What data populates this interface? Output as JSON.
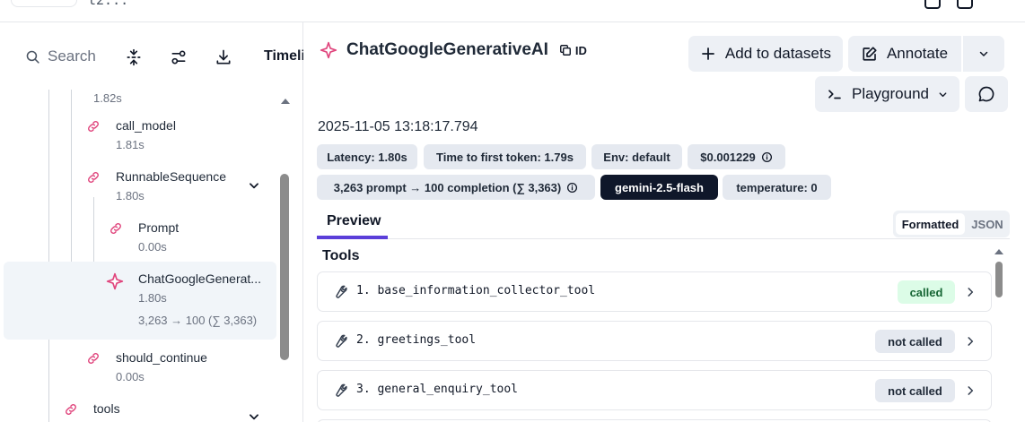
{
  "header": {
    "partial_id": "t2..."
  },
  "left_toolbar": {
    "search_placeholder": "Search",
    "timeline_tab": "Timeline"
  },
  "tree": {
    "top_duration": "1.82s",
    "nodes": [
      {
        "name": "call_model",
        "duration": "1.81s"
      },
      {
        "name": "RunnableSequence",
        "duration": "1.80s"
      },
      {
        "name": "Prompt",
        "duration": "0.00s"
      },
      {
        "name": "ChatGoogleGenerat...",
        "duration": "1.80s",
        "tokens": "3,263 → 100 (∑ 3,363)"
      },
      {
        "name": "should_continue",
        "duration": "0.00s"
      },
      {
        "name": "tools",
        "duration": ""
      }
    ]
  },
  "detail": {
    "title": "ChatGoogleGenerativeAI",
    "id_label": "ID",
    "buttons": {
      "add_to_datasets": "Add to datasets",
      "annotate": "Annotate",
      "playground": "Playground"
    },
    "timestamp": "2025-11-05 13:18:17.794",
    "chips_row1": [
      "Latency: 1.80s",
      "Time to first token: 1.79s",
      "Env: default",
      "$0.001229"
    ],
    "chips_row2": [
      "3,263 prompt → 100 completion (∑ 3,363)",
      "gemini-2.5-flash",
      "temperature: 0"
    ],
    "tabs": {
      "preview": "Preview",
      "formatted": "Formatted",
      "json": "JSON"
    },
    "tools_section_title": "Tools",
    "tools": [
      {
        "label": "1. base_information_collector_tool",
        "status": "called"
      },
      {
        "label": "2. greetings_tool",
        "status": "not called"
      },
      {
        "label": "3. general_enquiry_tool",
        "status": "not called"
      }
    ]
  },
  "colors": {
    "accent_tab": "#5b3fd9",
    "span_icon": "#e0447c",
    "called_bg": "#dcfce7",
    "called_text": "#166534",
    "model_chip_bg": "#0f172a"
  }
}
